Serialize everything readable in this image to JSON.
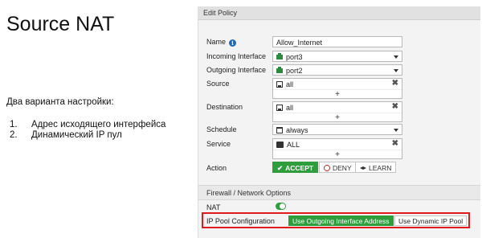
{
  "slide": {
    "title": "Source NAT",
    "subtitle": "Два варианта настройки:",
    "list": [
      {
        "num": "1.",
        "text": "Адрес исходящего интерфейса"
      },
      {
        "num": "2.",
        "text": "Динамический IP пул"
      }
    ]
  },
  "panel": {
    "header": "Edit Policy",
    "fields": {
      "name": {
        "label": "Name",
        "value": "Allow_Internet"
      },
      "incoming": {
        "label": "Incoming Interface",
        "value": "port3"
      },
      "outgoing": {
        "label": "Outgoing Interface",
        "value": "port2"
      },
      "source": {
        "label": "Source",
        "value": "all",
        "add": "+"
      },
      "destination": {
        "label": "Destination",
        "value": "all",
        "add": "+"
      },
      "schedule": {
        "label": "Schedule",
        "value": "always"
      },
      "service": {
        "label": "Service",
        "value": "ALL",
        "add": "+"
      },
      "action": {
        "label": "Action"
      }
    },
    "actions": {
      "accept": "ACCEPT",
      "deny": "DENY",
      "learn": "LEARN",
      "selected": "ACCEPT"
    },
    "section_title": "Firewall / Network Options",
    "nat": {
      "label": "NAT",
      "enabled": true
    },
    "ip_pool": {
      "label": "IP Pool Configuration",
      "options": [
        "Use Outgoing Interface Address",
        "Use Dynamic IP Pool"
      ],
      "selected": "Use Outgoing Interface Address"
    }
  },
  "colors": {
    "accent_green": "#2e9e3d",
    "highlight_red": "#e11b1b",
    "info_blue": "#2466b5"
  }
}
